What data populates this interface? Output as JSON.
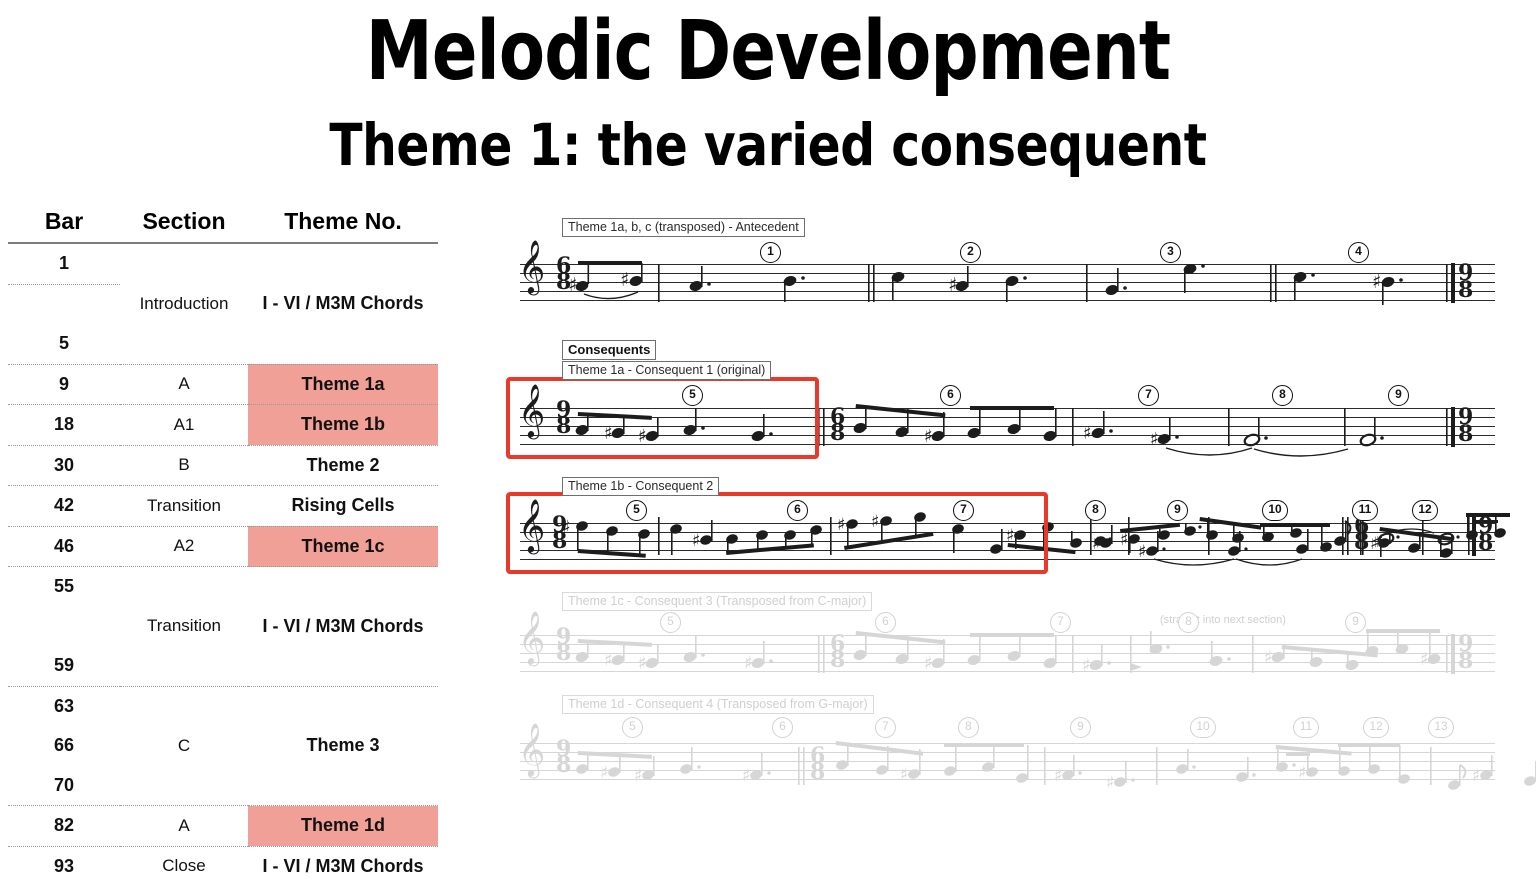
{
  "title": {
    "main": "Melodic Development",
    "sub": "Theme 1: the varied consequent"
  },
  "table": {
    "headers": [
      "Bar",
      "Section",
      "Theme No."
    ],
    "rows": [
      {
        "bar": "1",
        "section": "",
        "theme": "",
        "highlight": false
      },
      {
        "bar": "",
        "section": "Introduction",
        "theme": "I - VI / M3M Chords",
        "highlight": false
      },
      {
        "bar": "5",
        "section": "",
        "theme": "",
        "highlight": false
      },
      {
        "bar": "9",
        "section": "A",
        "theme": "Theme 1a",
        "highlight": true
      },
      {
        "bar": "18",
        "section": "A1",
        "theme": "Theme 1b",
        "highlight": true
      },
      {
        "bar": "30",
        "section": "B",
        "theme": "Theme 2",
        "highlight": false
      },
      {
        "bar": "42",
        "section": "Transition",
        "theme": "Rising Cells",
        "highlight": false
      },
      {
        "bar": "46",
        "section": "A2",
        "theme": "Theme 1c",
        "highlight": true
      },
      {
        "bar": "55",
        "section": "",
        "theme": "",
        "highlight": false
      },
      {
        "bar": "",
        "section": "Transition",
        "theme": "I - VI / M3M Chords",
        "highlight": false
      },
      {
        "bar": "59",
        "section": "",
        "theme": "",
        "highlight": false
      },
      {
        "bar": "63",
        "section": "",
        "theme": "",
        "highlight": false
      },
      {
        "bar": "66",
        "section": "C",
        "theme": "Theme 3",
        "highlight": false
      },
      {
        "bar": "70",
        "section": "",
        "theme": "",
        "highlight": false
      },
      {
        "bar": "82",
        "section": "A",
        "theme": "Theme 1d",
        "highlight": true
      },
      {
        "bar": "93",
        "section": "Close",
        "theme": "I - VI / M3M Chords",
        "highlight": false
      }
    ]
  },
  "music": {
    "systems": [
      {
        "id": "antecedent",
        "label": "Theme 1a, b, c (transposed) - Antecedent",
        "faded": false,
        "boxed": false,
        "clef": "treble",
        "time_start": "6/8",
        "time_end": "9/8",
        "measure_numbers": [
          "1",
          "2",
          "3",
          "4"
        ]
      },
      {
        "id": "consequent-1",
        "group_label": "Consequents",
        "label": "Theme 1a - Consequent 1 (original)",
        "faded": false,
        "boxed": true,
        "clef": "treble",
        "time_start": "9/8",
        "time_mid": "6/8",
        "time_end": "9/8",
        "measure_numbers": [
          "5",
          "6",
          "7",
          "8",
          "9"
        ]
      },
      {
        "id": "consequent-2",
        "label": "Theme 1b - Consequent 2",
        "faded": false,
        "boxed": true,
        "clef": "treble",
        "time_start": "9/8",
        "time_mid": "6/8",
        "time_end": "9/8",
        "measure_numbers": [
          "5",
          "6",
          "7",
          "8",
          "9",
          "10",
          "11",
          "12"
        ]
      },
      {
        "id": "consequent-3",
        "label": "Theme 1c - Consequent 3 (Transposed from C-major)",
        "annotation": "(straight into next section)",
        "faded": true,
        "boxed": false,
        "clef": "treble",
        "time_start": "9/8",
        "time_mid": "6/8",
        "time_end": "9/8",
        "measure_numbers": [
          "5",
          "6",
          "7",
          "8",
          "9"
        ]
      },
      {
        "id": "consequent-4",
        "label": "Theme 1d - Consequent 4 (Transposed from G-major)",
        "faded": true,
        "boxed": false,
        "clef": "treble",
        "time_start": "9/8",
        "time_mid": "6/8",
        "measure_numbers": [
          "5",
          "6",
          "7",
          "8",
          "9",
          "10",
          "11",
          "12",
          "13"
        ]
      }
    ]
  },
  "colors": {
    "highlight_fill": "#F0A097",
    "red_box": "#E8392A",
    "faded_ink": "#D6D6D6",
    "ink": "#1C1C1C"
  }
}
